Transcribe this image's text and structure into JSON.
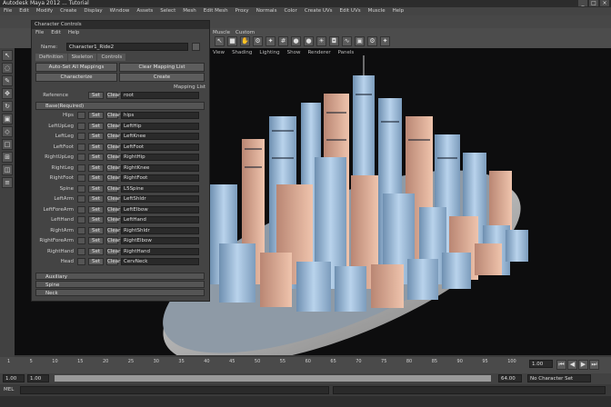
{
  "window": {
    "title": "Autodesk Maya 2012 ... Tutorial",
    "controls": [
      "_",
      "□",
      "×"
    ]
  },
  "menubar": {
    "items": [
      "File",
      "Edit",
      "Modify",
      "Create",
      "Display",
      "Window",
      "Assets",
      "Select",
      "Mesh",
      "Edit Mesh",
      "Proxy",
      "Normals",
      "Color",
      "Create UVs",
      "Edit UVs",
      "Muscle",
      "Help"
    ]
  },
  "shelf": {
    "tabs": [
      "Muscle",
      "Custom"
    ],
    "icons": [
      "arrow-icon",
      "box-icon",
      "hand-icon",
      "gear-icon",
      "star-icon",
      "grid-icon",
      "sphere-icon",
      "sphere-icon",
      "light-icon",
      "camera-icon",
      "curve-icon",
      "cube-icon",
      "gear-icon",
      "star-icon"
    ]
  },
  "viewport": {
    "menu": [
      "View",
      "Shading",
      "Lighting",
      "Show",
      "Renderer",
      "Panels"
    ]
  },
  "character_controls": {
    "title": "Character Controls",
    "menu": [
      "File",
      "Edit",
      "Help"
    ],
    "name_label": "Name:",
    "name_value": "Character1_Ride2",
    "tabs": [
      "Definition",
      "Skeleton",
      "Controls"
    ],
    "buttons": {
      "auto_set": "Auto-Set All Mappings",
      "clear": "Clear Mapping List",
      "characterize": "Characterize",
      "create": "Create"
    },
    "mapping_list_label": "Mapping List",
    "reference": {
      "label": "Reference",
      "set": "Set",
      "clear": "Clear",
      "value": "root"
    },
    "base_section": "Base(Required)",
    "rows": [
      {
        "label": "Hips",
        "set": "Set",
        "clear": "Clear",
        "value": "hips"
      },
      {
        "label": "LeftUpLeg",
        "set": "Set",
        "clear": "Clear",
        "value": "LeftHip"
      },
      {
        "label": "LeftLeg",
        "set": "Set",
        "clear": "Clear",
        "value": "LeftKnee"
      },
      {
        "label": "LeftFoot",
        "set": "Set",
        "clear": "Clear",
        "value": "LeftFoot"
      },
      {
        "label": "RightUpLeg",
        "set": "Set",
        "clear": "Clear",
        "value": "RightHip"
      },
      {
        "label": "RightLeg",
        "set": "Set",
        "clear": "Clear",
        "value": "RightKnee"
      },
      {
        "label": "RightFoot",
        "set": "Set",
        "clear": "Clear",
        "value": "RightFoot"
      },
      {
        "label": "Spine",
        "set": "Set",
        "clear": "Clear",
        "value": "L5Spine"
      },
      {
        "label": "LeftArm",
        "set": "Set",
        "clear": "Clear",
        "value": "LeftShldr"
      },
      {
        "label": "LeftForeArm",
        "set": "Set",
        "clear": "Clear",
        "value": "LeftElbow"
      },
      {
        "label": "LeftHand",
        "set": "Set",
        "clear": "Clear",
        "value": "LeftHand"
      },
      {
        "label": "RightArm",
        "set": "Set",
        "clear": "Clear",
        "value": "RightShldr"
      },
      {
        "label": "RightForeArm",
        "set": "Set",
        "clear": "Clear",
        "value": "RightElbow"
      },
      {
        "label": "RightHand",
        "set": "Set",
        "clear": "Clear",
        "value": "RightHand"
      },
      {
        "label": "Head",
        "set": "Set",
        "clear": "Clear",
        "value": "CervNeck"
      }
    ],
    "extra_sections": [
      "Auxiliary",
      "Spine",
      "Neck"
    ]
  },
  "timeline": {
    "ticks": [
      "1",
      "5",
      "10",
      "15",
      "20",
      "25",
      "30",
      "35",
      "40",
      "45",
      "50",
      "55",
      "60",
      "65",
      "70",
      "75",
      "80",
      "85",
      "90",
      "95",
      "100"
    ],
    "range_start": "1.00",
    "range_end": "1.00",
    "current": "1.00",
    "playback_end": "64.00",
    "character_set": "No Character Set"
  },
  "cmdline": {
    "label": "MEL"
  },
  "colors": {
    "accent": "#e8e8e8",
    "panel": "#444444",
    "field": "#2a2a2a",
    "viewport": "#0d0d0e",
    "building_blue": "#a9c6e2",
    "building_peach": "#e2b39b"
  }
}
